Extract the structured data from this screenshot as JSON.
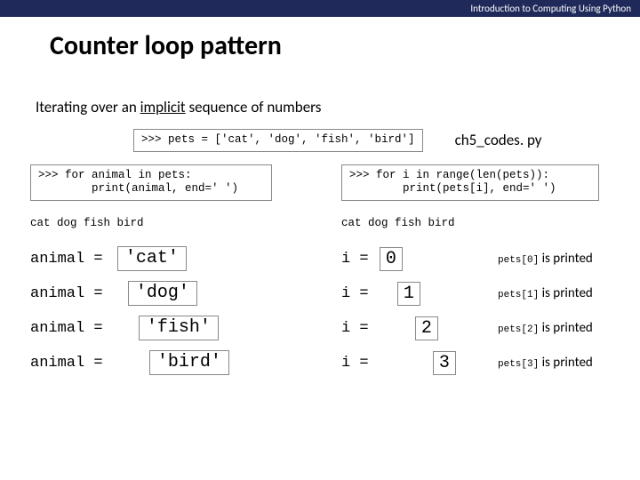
{
  "header": {
    "course": "Introduction to Computing Using Python"
  },
  "title": "Counter loop pattern",
  "subtitle_prefix": "Iterating over an ",
  "subtitle_underlined": "implicit",
  "subtitle_suffix": " sequence of numbers",
  "file_label": "ch5_codes. py",
  "top_code": ">>> pets = ['cat', 'dog', 'fish', 'bird']",
  "left": {
    "code": ">>> for animal in pets:\n        print(animal, end=' ')",
    "output": "cat dog fish bird",
    "label": "animal = ",
    "steps": [
      {
        "val": "'cat'"
      },
      {
        "val": "'dog'"
      },
      {
        "val": "'fish'"
      },
      {
        "val": "'bird'"
      }
    ]
  },
  "right": {
    "code": ">>> for i in range(len(pets)):\n        print(pets[i], end=' ')",
    "output": "cat dog fish bird",
    "label": "i = ",
    "steps": [
      {
        "val": "0",
        "printed_code": "pets[0]",
        "printed_text": " is printed"
      },
      {
        "val": "1",
        "printed_code": "pets[1]",
        "printed_text": " is printed"
      },
      {
        "val": "2",
        "printed_code": "pets[2]",
        "printed_text": " is printed"
      },
      {
        "val": "3",
        "printed_code": "pets[3]",
        "printed_text": " is printed"
      }
    ]
  }
}
